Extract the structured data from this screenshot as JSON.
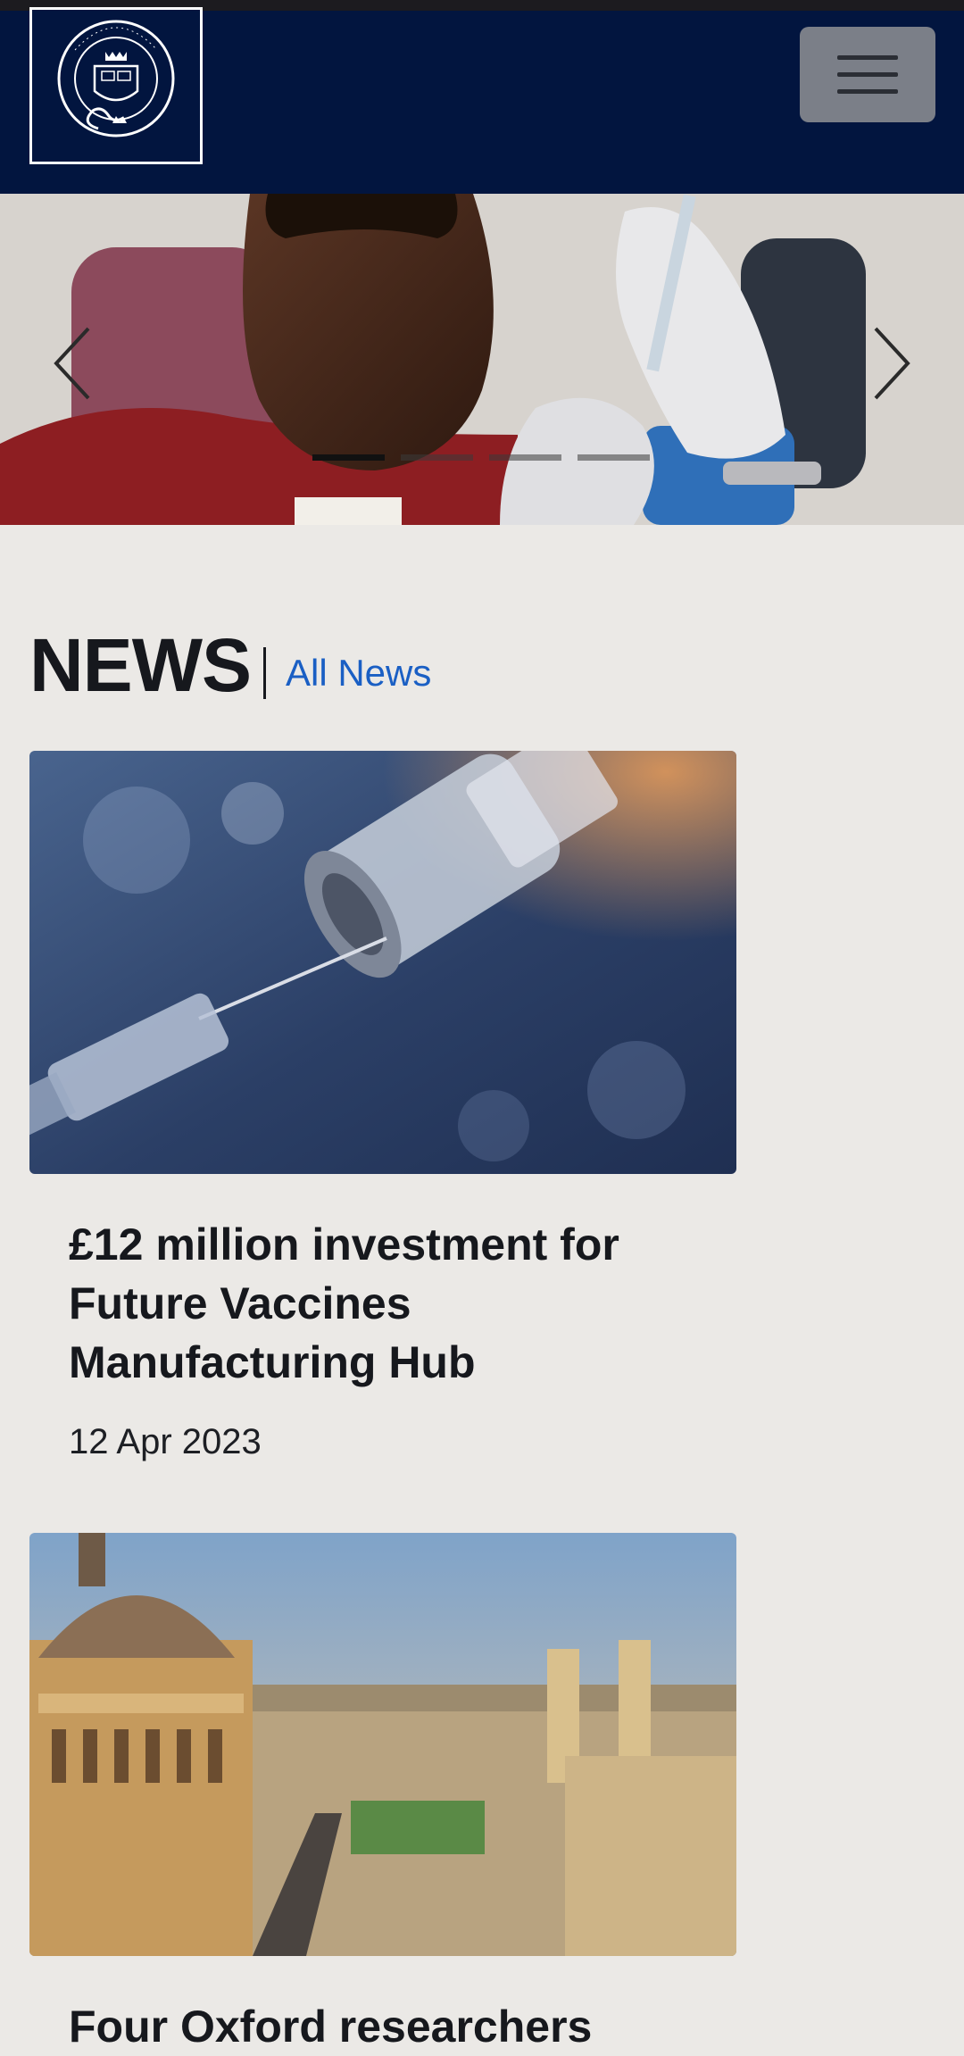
{
  "header": {
    "logo_alt": "University of Oxford",
    "menu_icon": "hamburger-icon"
  },
  "hero": {
    "prev_icon": "chevron-left-icon",
    "next_icon": "chevron-right-icon",
    "slides_count": 4,
    "active_slide": 1
  },
  "news": {
    "heading": "NEWS",
    "all_link": "All News",
    "items": [
      {
        "title": "£12 million investment for Future Vaccines Manufacturing Hub",
        "date": "12 Apr 2023"
      },
      {
        "title": "Four Oxford researchers",
        "date": ""
      }
    ]
  },
  "colors": {
    "header_bg": "#02153f",
    "page_bg": "#ebe9e6",
    "link": "#1a5fc4"
  }
}
